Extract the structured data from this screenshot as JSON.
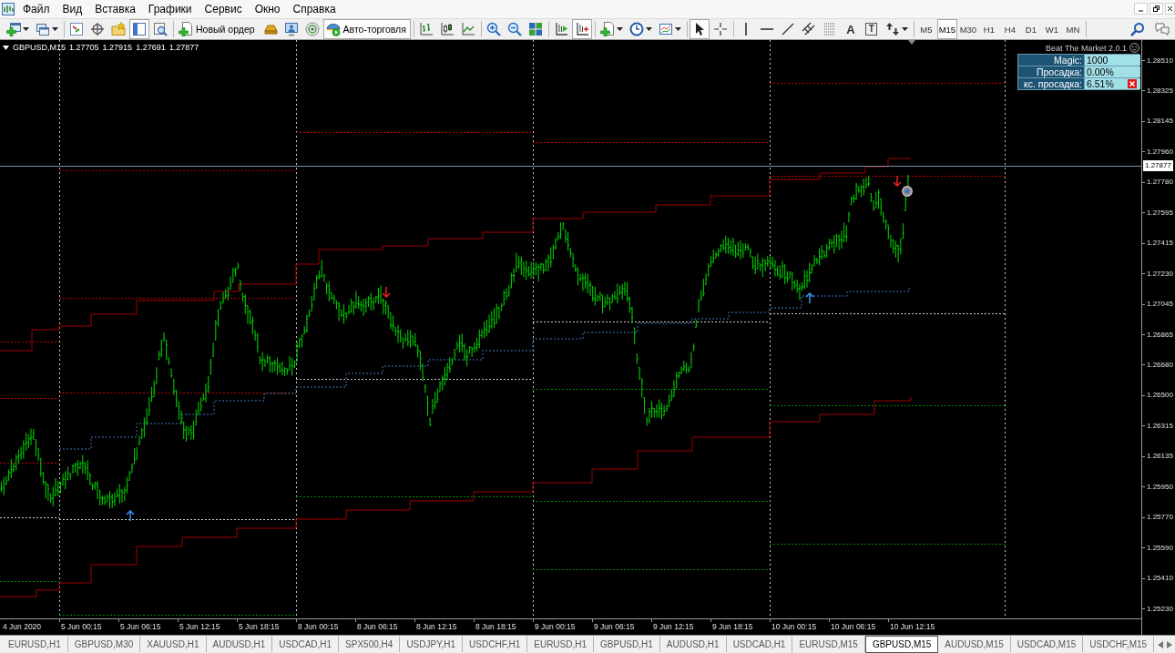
{
  "menu": [
    "Файл",
    "Вид",
    "Вставка",
    "Графики",
    "Сервис",
    "Окно",
    "Справка"
  ],
  "toolbar": {
    "groups": [
      [
        {
          "pressed": false
        },
        {
          "pressed": false
        }
      ],
      [
        {
          "pressed": false
        },
        {
          "pressed": false
        },
        {
          "pressed": false
        },
        {
          "pressed": true
        },
        {
          "pressed": false
        }
      ],
      [
        {
          "label": "Новый ордер",
          "pressed": false
        },
        {
          "pressed": false
        },
        {
          "pressed": false
        },
        {
          "pressed": false
        },
        {
          "label": "Авто-торговля",
          "pressed": true
        }
      ],
      [
        {
          "pressed": false
        },
        {
          "pressed": false
        },
        {
          "pressed": false
        }
      ],
      [
        {
          "pressed": false
        },
        {
          "pressed": false
        },
        {
          "pressed": false
        }
      ],
      [
        {
          "pressed": false
        },
        {
          "pressed": true
        }
      ],
      [
        {
          "pressed": false
        },
        {
          "pressed": false
        },
        {
          "pressed": false
        }
      ],
      [
        {
          "pressed": true
        },
        {
          "pressed": false
        }
      ],
      [
        {
          "pressed": false
        },
        {
          "pressed": false
        },
        {
          "pressed": false
        },
        {
          "pressed": false
        },
        {
          "pressed": false
        },
        {
          "label": "A",
          "pressed": false
        },
        {
          "label": "T",
          "pressed": false
        },
        {
          "pressed": false
        }
      ]
    ],
    "timeframes": [
      {
        "label": "M5",
        "selected": false
      },
      {
        "label": "M15",
        "selected": true
      },
      {
        "label": "M30",
        "selected": false
      },
      {
        "label": "H1",
        "selected": false
      },
      {
        "label": "H4",
        "selected": false
      },
      {
        "label": "D1",
        "selected": false
      },
      {
        "label": "W1",
        "selected": false
      },
      {
        "label": "MN",
        "selected": false
      }
    ]
  },
  "chart": {
    "symbol": "GBPUSD,M15",
    "quotes": [
      "1.27705",
      "1.27915",
      "1.27691",
      "1.27877"
    ],
    "expert": {
      "title": "Beat The Market 2.0.1",
      "rows": [
        {
          "label": "Magic:",
          "value": "1000"
        },
        {
          "label": "Просадка:",
          "value": "0.00%"
        },
        {
          "label": "кс. просадка:",
          "value": "6.51%"
        }
      ]
    },
    "price_axis": {
      "labels": [
        "1.28510",
        "1.28325",
        "1.28145",
        "1.27960",
        "1.27780",
        "1.27595",
        "1.27415",
        "1.27230",
        "1.27045",
        "1.26865",
        "1.26680",
        "1.26500",
        "1.26315",
        "1.26135",
        "1.25950",
        "1.25770",
        "1.25590",
        "1.25410",
        "1.25230"
      ],
      "current": "1.27877"
    },
    "time_axis": [
      "4 Jun 2020",
      "5 Jun 00:15",
      "5 Jun 06:15",
      "5 Jun 12:15",
      "5 Jun 18:15",
      "8 Jun 00:15",
      "8 Jun 06:15",
      "8 Jun 12:15",
      "8 Jun 18:15",
      "9 Jun 00:15",
      "9 Jun 06:15",
      "9 Jun 12:15",
      "9 Jun 18:15",
      "10 Jun 00:15",
      "10 Jun 06:15",
      "10 Jun 12:15"
    ]
  },
  "tabs": [
    {
      "label": "EURUSD,H1",
      "selected": false
    },
    {
      "label": "GBPUSD,M30",
      "selected": false
    },
    {
      "label": "XAUUSD,H1",
      "selected": false
    },
    {
      "label": "AUDUSD,H1",
      "selected": false
    },
    {
      "label": "USDCAD,H1",
      "selected": false
    },
    {
      "label": "SPX500,H4",
      "selected": false
    },
    {
      "label": "USDJPY,H1",
      "selected": false
    },
    {
      "label": "USDCHF,H1",
      "selected": false
    },
    {
      "label": "EURUSD,H1",
      "selected": false
    },
    {
      "label": "GBPUSD,H1",
      "selected": false
    },
    {
      "label": "AUDUSD,H1",
      "selected": false
    },
    {
      "label": "USDCAD,H1",
      "selected": false
    },
    {
      "label": "EURUSD,M15",
      "selected": false
    },
    {
      "label": "GBPUSD,M15",
      "selected": true
    },
    {
      "label": "AUDUSD,M15",
      "selected": false
    },
    {
      "label": "USDCAD,M15",
      "selected": false
    },
    {
      "label": "USDCHF,M15",
      "selected": false
    }
  ]
}
